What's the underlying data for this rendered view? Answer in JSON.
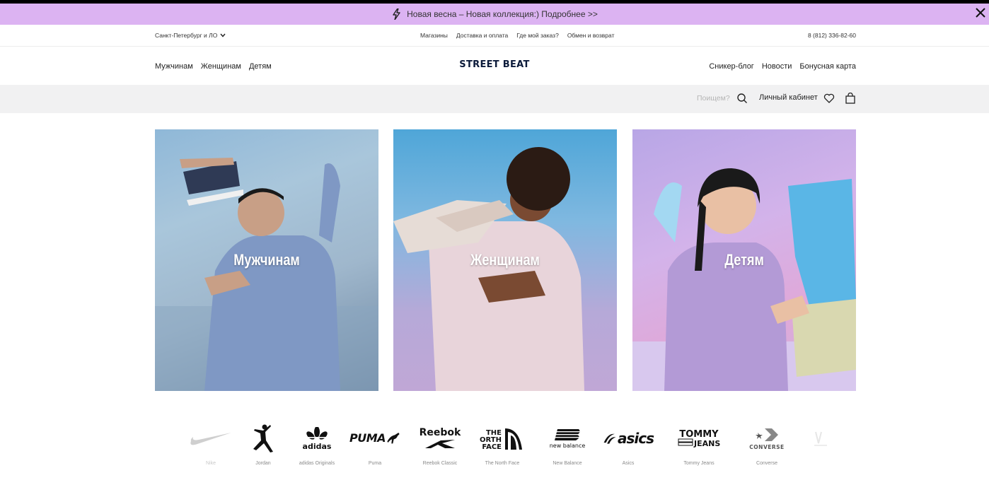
{
  "promo": {
    "text": "Новая весна – Новая коллекция:) Подробнее >>"
  },
  "util": {
    "city": "Санкт-Петербург и ЛО",
    "links": [
      "Магазины",
      "Доставка и оплата",
      "Где мой заказ?",
      "Обмен и возврат"
    ],
    "phone": "8 (812) 336-82-60"
  },
  "nav": {
    "left": [
      "Мужчинам",
      "Женщинам",
      "Детям"
    ],
    "logo": "STREET BEAT",
    "right": [
      "Сникер-блог",
      "Новости",
      "Бонусная карта"
    ]
  },
  "search": {
    "placeholder": "Поищем?",
    "cabinet": "Личный кабинет"
  },
  "tiles": [
    "Мужчинам",
    "Женщинам",
    "Детям"
  ],
  "brands": [
    {
      "name": "Nike",
      "icon": "nike-swoosh-icon"
    },
    {
      "name": "Jordan",
      "icon": "jumpman-icon"
    },
    {
      "name": "adidas Originals",
      "icon": "adidas-trefoil-icon",
      "logo_text": "adidas"
    },
    {
      "name": "Puma",
      "icon": "puma-icon",
      "logo_text": "PUMA"
    },
    {
      "name": "Reebok Classic",
      "icon": "reebok-icon",
      "logo_text": "Reebok"
    },
    {
      "name": "The North Face",
      "icon": "north-face-icon",
      "logo_text": "THE NORTH FACE"
    },
    {
      "name": "New Balance",
      "icon": "new-balance-icon",
      "logo_text": "new balance"
    },
    {
      "name": "Asics",
      "icon": "asics-icon",
      "logo_text": "asics"
    },
    {
      "name": "Tommy Jeans",
      "icon": "tommy-jeans-icon",
      "logo_text": "TOMMY JEANS"
    },
    {
      "name": "Converse",
      "icon": "converse-icon",
      "logo_text": "CONVERSE"
    }
  ],
  "colors": {
    "promo_bg": "#dcb3f2",
    "strip_bg": "#f1f1f2",
    "logo": "#0b1a3a"
  }
}
